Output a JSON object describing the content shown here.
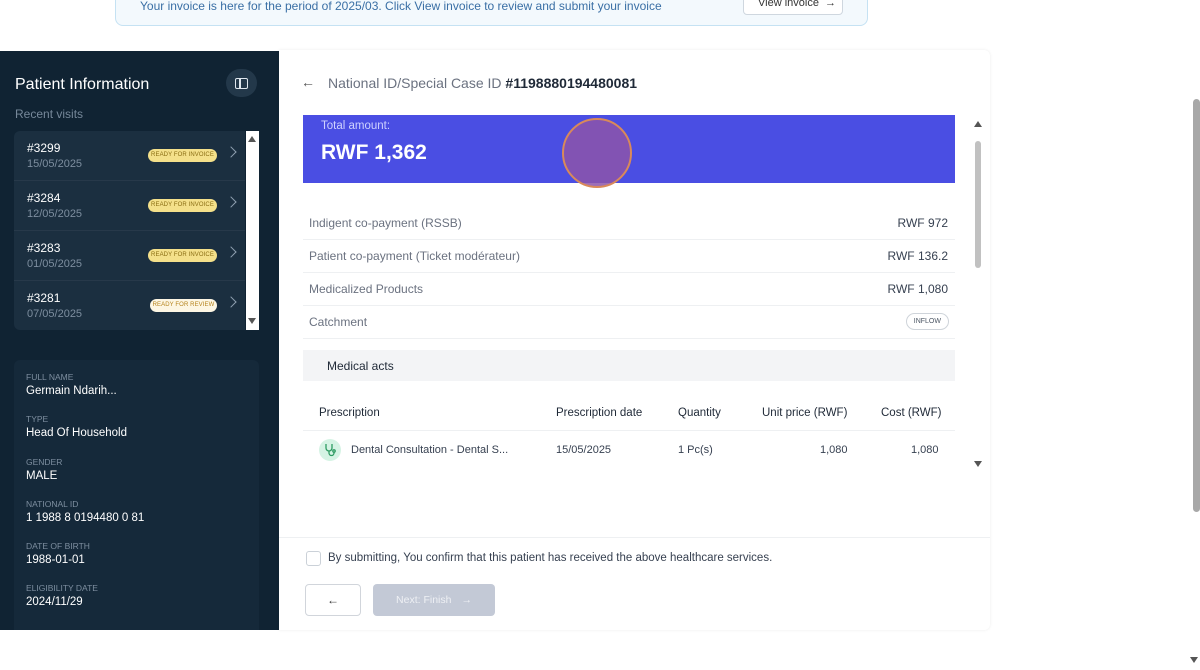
{
  "banner": {
    "text": "Your invoice is here for the period of 2025/03. Click View invoice to review and submit your invoice",
    "button_label": "View invoice",
    "button_arrow": "→"
  },
  "sidebar": {
    "title": "Patient Information",
    "recent_label": "Recent visits",
    "visits": [
      {
        "number": "#3299",
        "date": "15/05/2025",
        "status": "READY FOR INVOICE"
      },
      {
        "number": "#3284",
        "date": "12/05/2025",
        "status": "READY FOR INVOICE"
      },
      {
        "number": "#3283",
        "date": "01/05/2025",
        "status": "READY FOR INVOICE"
      },
      {
        "number": "#3281",
        "date": "07/05/2025",
        "status": "READY FOR REVIEW"
      }
    ],
    "details": [
      {
        "label": "Full Name",
        "value": "Germain Ndarih..."
      },
      {
        "label": "Type",
        "value": "Head Of Household"
      },
      {
        "label": "Gender",
        "value": "MALE"
      },
      {
        "label": "National ID",
        "value": "1 1988 8 0194480 0 81"
      },
      {
        "label": "Date of Birth",
        "value": "1988-01-01"
      },
      {
        "label": "Eligibility Date",
        "value": "2024/11/29"
      }
    ]
  },
  "header": {
    "back_icon": "←",
    "id_label": "National ID/Special Case ID",
    "id_value": "#1198880194480081"
  },
  "total": {
    "label": "Total amount:",
    "value": "RWF 1,362"
  },
  "breakdown": [
    {
      "label": "Indigent co-payment (RSSB)",
      "value": "RWF 972"
    },
    {
      "label": "Patient co-payment (Ticket modérateur)",
      "value": "RWF 136.2"
    },
    {
      "label": "Medicalized Products",
      "value": "RWF 1,080"
    }
  ],
  "catchment": {
    "label": "Catchment",
    "value": "INFLOW"
  },
  "medical_acts": {
    "title": "Medical acts",
    "columns": [
      "Prescription",
      "Prescription date",
      "Quantity",
      "Unit price (RWF)",
      "Cost (RWF)"
    ],
    "rows": [
      {
        "prescription": "Dental Consultation - Dental S...",
        "date": "15/05/2025",
        "quantity": "1 Pc(s)",
        "unit_price": "1,080",
        "cost": "1,080"
      }
    ]
  },
  "footer": {
    "confirm_text": "By submitting, You confirm that this patient has received the above healthcare services.",
    "back_icon": "←",
    "next_label": "Next: Finish",
    "next_arrow": "→"
  },
  "colors": {
    "sidebar_bg": "#102333",
    "total_bg": "#4a4ee3",
    "badge_invoice": "#f4e08a",
    "badge_review": "#fdf6e3",
    "disabled_button": "#c3c9d6"
  },
  "icons": [
    "arrow-right-icon",
    "panel-toggle-icon",
    "chevron-right-icon",
    "arrow-left-icon",
    "stethoscope-icon",
    "checkbox-icon"
  ]
}
